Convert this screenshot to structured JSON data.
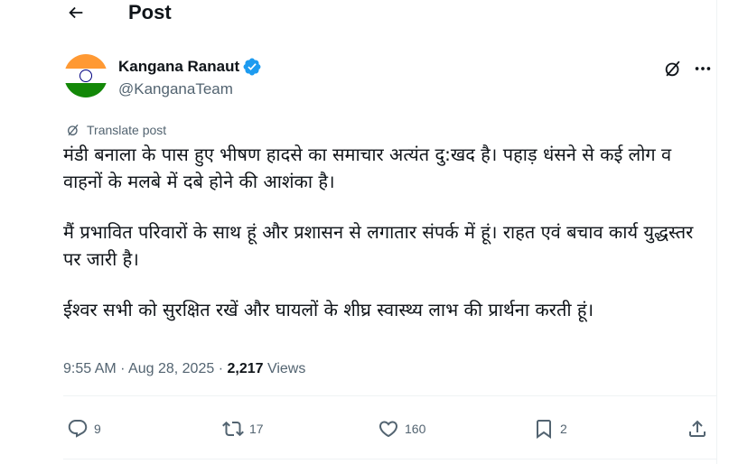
{
  "header": {
    "title": "Post"
  },
  "author": {
    "display_name": "Kangana Ranaut",
    "handle": "@KanganaTeam",
    "avatar": "india-flag-avatar",
    "verified": true,
    "verified_color": "#1d9bf0"
  },
  "translate_label": "Translate post",
  "tweet": {
    "paragraphs": [
      "मंडी बनाला के पास हुए भीषण हादसे का समाचार अत्यंत दु:खद है। पहाड़ धंसने से कई लोग व वाहनों के मलबे में दबे होने की आशंका है।",
      "मैं प्रभावित परिवारों के साथ हूं और प्रशासन से लगातार संपर्क में हूं। राहत एवं बचाव कार्य युद्धस्तर पर जारी है।",
      "ईश्वर सभी को सुरक्षित रखें और घायलों के शीघ्र स्वास्थ्य लाभ की प्रार्थना करती हूं।"
    ]
  },
  "meta": {
    "time": "9:55 AM",
    "separator": " · ",
    "date": "Aug 28, 2025",
    "views_count": "2,217",
    "views_label": " Views"
  },
  "actions": {
    "replies": "9",
    "reposts": "17",
    "likes": "160",
    "bookmarks": "2"
  },
  "colors": {
    "text": "#0f1419",
    "secondary": "#536471",
    "divider": "#eff3f4",
    "saffron": "#ff9933",
    "green": "#138808",
    "chakra": "#000080"
  }
}
